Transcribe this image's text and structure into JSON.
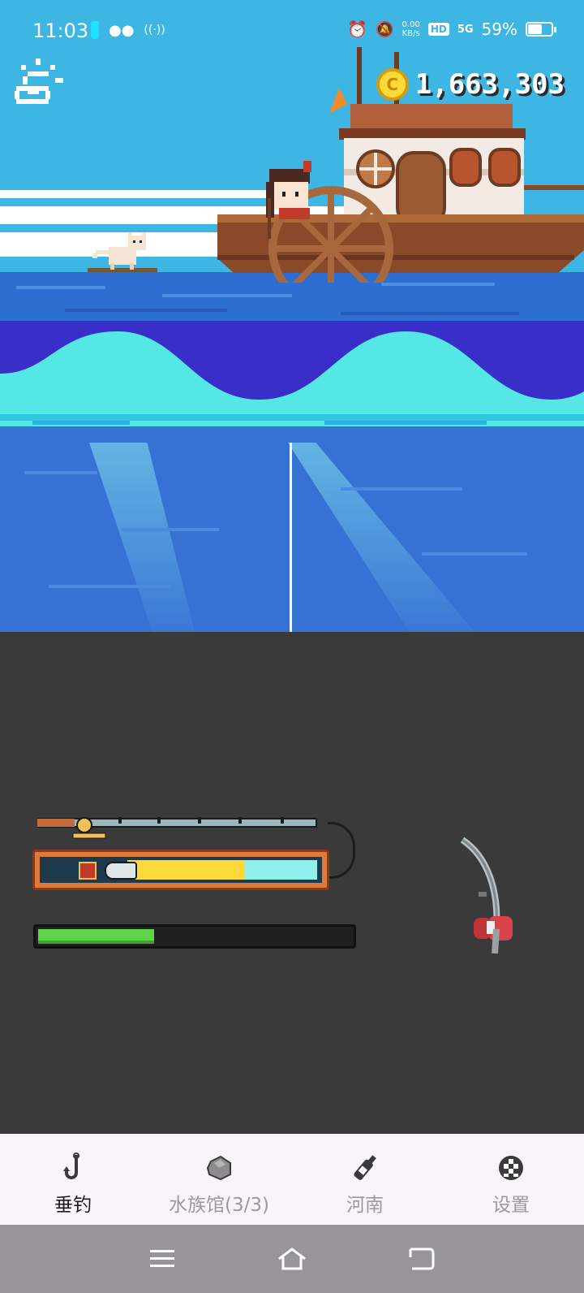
{
  "status_bar": {
    "time": "11:03",
    "net_speed_value": "0.00",
    "net_speed_unit": "KB/s",
    "hd": "HD",
    "signal": "5G",
    "battery": "59%",
    "battery_level": 0.59
  },
  "hud": {
    "coin_icon": "coin-icon",
    "coins": "1,663,303",
    "weather_icon": "cloudy-sun-icon"
  },
  "fishing": {
    "tension_yellow_level": 0.42,
    "progress_level": 0.37
  },
  "tabs": [
    {
      "label": "垂钓",
      "icon": "hook-icon",
      "active": true
    },
    {
      "label": "水族馆(3/3)",
      "icon": "stone-icon",
      "active": false
    },
    {
      "label": "河南",
      "icon": "bottle-icon",
      "active": false
    },
    {
      "label": "设置",
      "icon": "settings-icon",
      "active": false
    }
  ],
  "system_nav": {
    "menu": "menu-icon",
    "home": "home-icon",
    "back": "back-icon"
  },
  "colors": {
    "sky": "#3db6e4",
    "deep_water": "#3a2ec8",
    "wave": "#55e6e6",
    "panel": "#3a3a3a",
    "progress": "#5fd34a",
    "tension_frame": "#e07a3a"
  }
}
